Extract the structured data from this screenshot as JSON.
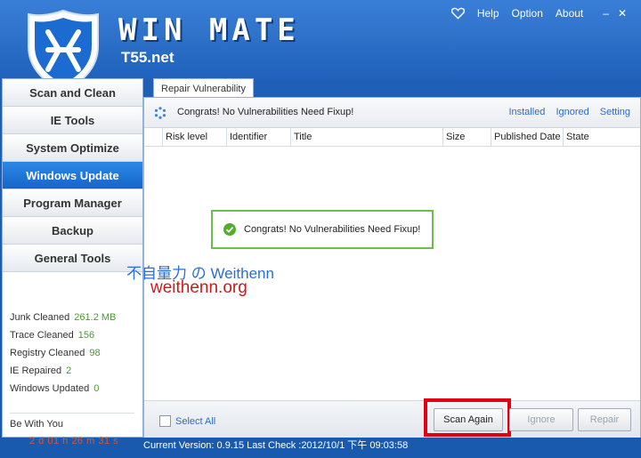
{
  "app": {
    "brand": "WIN MATE",
    "domain": "T55.net",
    "menu": [
      "Help",
      "Option",
      "About"
    ]
  },
  "sidebar": {
    "items": [
      {
        "label": "Scan and Clean"
      },
      {
        "label": "IE Tools"
      },
      {
        "label": "System Optimize"
      },
      {
        "label": "Windows Update",
        "active": true
      },
      {
        "label": "Program Manager"
      },
      {
        "label": "Backup"
      },
      {
        "label": "General Tools"
      }
    ],
    "stats": [
      {
        "label": "Junk Cleaned",
        "value": "261.2 MB"
      },
      {
        "label": "Trace Cleaned",
        "value": "156"
      },
      {
        "label": "Registry Cleaned",
        "value": "98"
      },
      {
        "label": "IE Repaired",
        "value": "2"
      },
      {
        "label": "Windows Updated",
        "value": "0"
      }
    ],
    "bewith_label": "Be With You",
    "timer": "2 d 01 h 26 m 31 s"
  },
  "main": {
    "tab": "Repair Vulnerability",
    "info_message": "Congrats! No Vulnerabilities Need Fixup!",
    "links": [
      "Installed",
      "Ignored",
      "Setting"
    ],
    "columns": [
      "Risk level",
      "Identifier",
      "Title",
      "Size",
      "Published Date",
      "State"
    ],
    "empty_message": "Congrats! No Vulnerabilities Need Fixup!",
    "select_all": "Select All",
    "buttons": {
      "scan_again": "Scan Again",
      "ignore": "Ignore",
      "repair": "Repair"
    }
  },
  "watermark": {
    "line1": "不自量力 の Weithenn",
    "line2": "weithenn.org"
  },
  "status": {
    "text": "Current Version: 0.9.15   Last Check :2012/10/1 下午 09:03:58"
  },
  "colors": {
    "accent": "#1f61ba",
    "active_nav": "#1565c8",
    "highlight": "#e3000f",
    "success": "#6dbd4a"
  }
}
